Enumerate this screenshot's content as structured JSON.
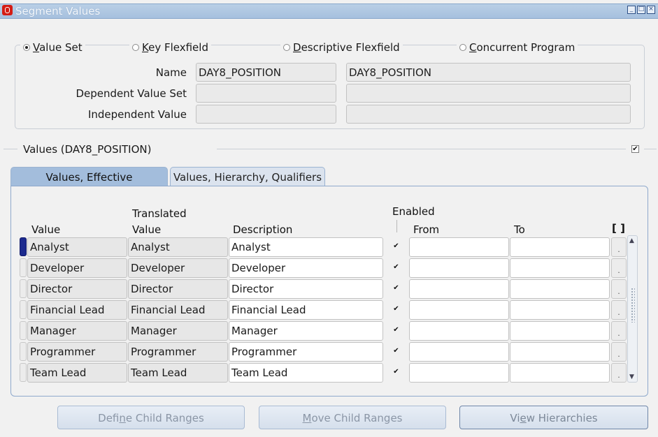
{
  "window": {
    "title": "Segment Values"
  },
  "source_options": [
    {
      "prefix": "V",
      "label": "alue Set",
      "selected": true
    },
    {
      "prefix": "K",
      "label": "ey Flexfield",
      "selected": false
    },
    {
      "prefix": "D",
      "label": "escriptive Flexfield",
      "selected": false
    },
    {
      "prefix": "C",
      "label": "oncurrent Program",
      "selected": false
    }
  ],
  "header_fields": {
    "name_label": "Name",
    "name_value": "DAY8_POSITION",
    "name_desc": "DAY8_POSITION",
    "dependent_label": "Dependent Value Set",
    "dependent_value": "",
    "dependent_desc": "",
    "independent_label": "Independent Value",
    "independent_value": "",
    "independent_desc": ""
  },
  "values_section": {
    "title": "Values (DAY8_POSITION)",
    "checked": true
  },
  "tabs": [
    {
      "label": "Values, Effective",
      "active": true
    },
    {
      "label": "Values, Hierarchy, Qualifiers",
      "active": false
    }
  ],
  "columns": {
    "value": "Value",
    "translated_top": "Translated",
    "translated_bottom": "Value",
    "description": "Description",
    "enabled": "Enabled",
    "from": "From",
    "to": "To",
    "brackets": "[ ]"
  },
  "rows": [
    {
      "value": "Analyst",
      "translated": "Analyst",
      "description": "Analyst",
      "enabled": true,
      "from": "",
      "to": "",
      "current": true
    },
    {
      "value": "Developer",
      "translated": "Developer",
      "description": "Developer",
      "enabled": true,
      "from": "",
      "to": "",
      "current": false
    },
    {
      "value": "Director",
      "translated": "Director",
      "description": "Director",
      "enabled": true,
      "from": "",
      "to": "",
      "current": false
    },
    {
      "value": "Financial Lead",
      "translated": "Financial Lead",
      "description": "Financial Lead",
      "enabled": true,
      "from": "",
      "to": "",
      "current": false
    },
    {
      "value": "Manager",
      "translated": "Manager",
      "description": "Manager",
      "enabled": true,
      "from": "",
      "to": "",
      "current": false
    },
    {
      "value": "Programmer",
      "translated": "Programmer",
      "description": "Programmer",
      "enabled": true,
      "from": "",
      "to": "",
      "current": false
    },
    {
      "value": "Team Lead",
      "translated": "Team Lead",
      "description": "Team Lead",
      "enabled": true,
      "from": "",
      "to": "",
      "current": false
    }
  ],
  "buttons": [
    {
      "pre": "Defi",
      "mn": "n",
      "post": "e Child Ranges",
      "enabled": false
    },
    {
      "pre": "",
      "mn": "M",
      "post": "ove Child Ranges",
      "enabled": false
    },
    {
      "pre": "Vi",
      "mn": "e",
      "post": "w Hierarchies",
      "enabled": true
    }
  ],
  "icons": {
    "app": "oracle-logo-icon",
    "minimize": "minimize-icon",
    "maximize": "maximize-icon",
    "close": "close-icon",
    "scroll_up": "scroll-up-icon",
    "scroll_down": "scroll-down-icon"
  },
  "colors": {
    "tab_active": "#a3bddc",
    "tab_inactive": "#dbe3ee",
    "row_current_marker": "#1c2a8e",
    "title_bar": "#b9cfe6"
  }
}
